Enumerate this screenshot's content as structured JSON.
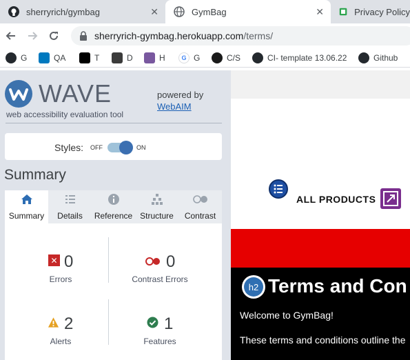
{
  "browser": {
    "tabs": [
      {
        "title": "sherryrich/gymbag",
        "icon": "github-icon",
        "active": false
      },
      {
        "title": "GymBag",
        "icon": "globe-icon",
        "active": true
      },
      {
        "title": "Privacy Policy",
        "icon": "policy-icon",
        "active": false
      }
    ],
    "close_glyph": "✕",
    "url_host": "sherryrich-gymbag.herokuapp.com",
    "url_path": "/terms/",
    "bookmarks": [
      {
        "label": "G",
        "icon": "github-icon",
        "color": "#24292e"
      },
      {
        "label": "QA",
        "icon": "trello-icon",
        "color": "#0079bf"
      },
      {
        "label": "T",
        "icon": "teamcity-icon",
        "color": "#000000"
      },
      {
        "label": "D",
        "icon": "dev-icon",
        "color": "#3b3b3b"
      },
      {
        "label": "H",
        "icon": "heroku-icon",
        "color": "#79589f"
      },
      {
        "label": "G",
        "icon": "google-icon",
        "color": "#4285f4"
      },
      {
        "label": "C/S",
        "icon": "codestar-icon",
        "color": "#1a1a1a"
      },
      {
        "label": "CI- template 13.06.22",
        "icon": "github-icon",
        "color": "#24292e"
      },
      {
        "label": "Github",
        "icon": "github-icon",
        "color": "#24292e"
      }
    ]
  },
  "wave": {
    "title": "WAVE",
    "subtitle": "web accessibility evaluation tool",
    "powered_by": "powered by",
    "powered_link": "WebAIM",
    "styles_label": "Styles:",
    "toggle_off": "OFF",
    "toggle_on": "ON",
    "summary_heading": "Summary",
    "tabs": [
      {
        "label": "Summary",
        "icon": "home-icon",
        "active": true
      },
      {
        "label": "Details",
        "icon": "list-icon",
        "active": false
      },
      {
        "label": "Reference",
        "icon": "info-icon",
        "active": false
      },
      {
        "label": "Structure",
        "icon": "hierarchy-icon",
        "active": false
      },
      {
        "label": "Contrast",
        "icon": "contrast-icon",
        "active": false
      }
    ],
    "stats": {
      "errors": {
        "count": "0",
        "label": "Errors",
        "color": "#c62828"
      },
      "contrast_errors": {
        "count": "0",
        "label": "Contrast Errors",
        "color": "#c62828"
      },
      "alerts": {
        "count": "2",
        "label": "Alerts",
        "color": "#e5a123"
      },
      "features": {
        "count": "1",
        "label": "Features",
        "color": "#2e7d4f"
      }
    }
  },
  "page": {
    "all_products": "ALL PRODUCTS",
    "h2_badge": "h2",
    "heading": "Terms and Con",
    "welcome": "Welcome to GymBag!",
    "terms_intro": "These terms and conditions outline the"
  }
}
